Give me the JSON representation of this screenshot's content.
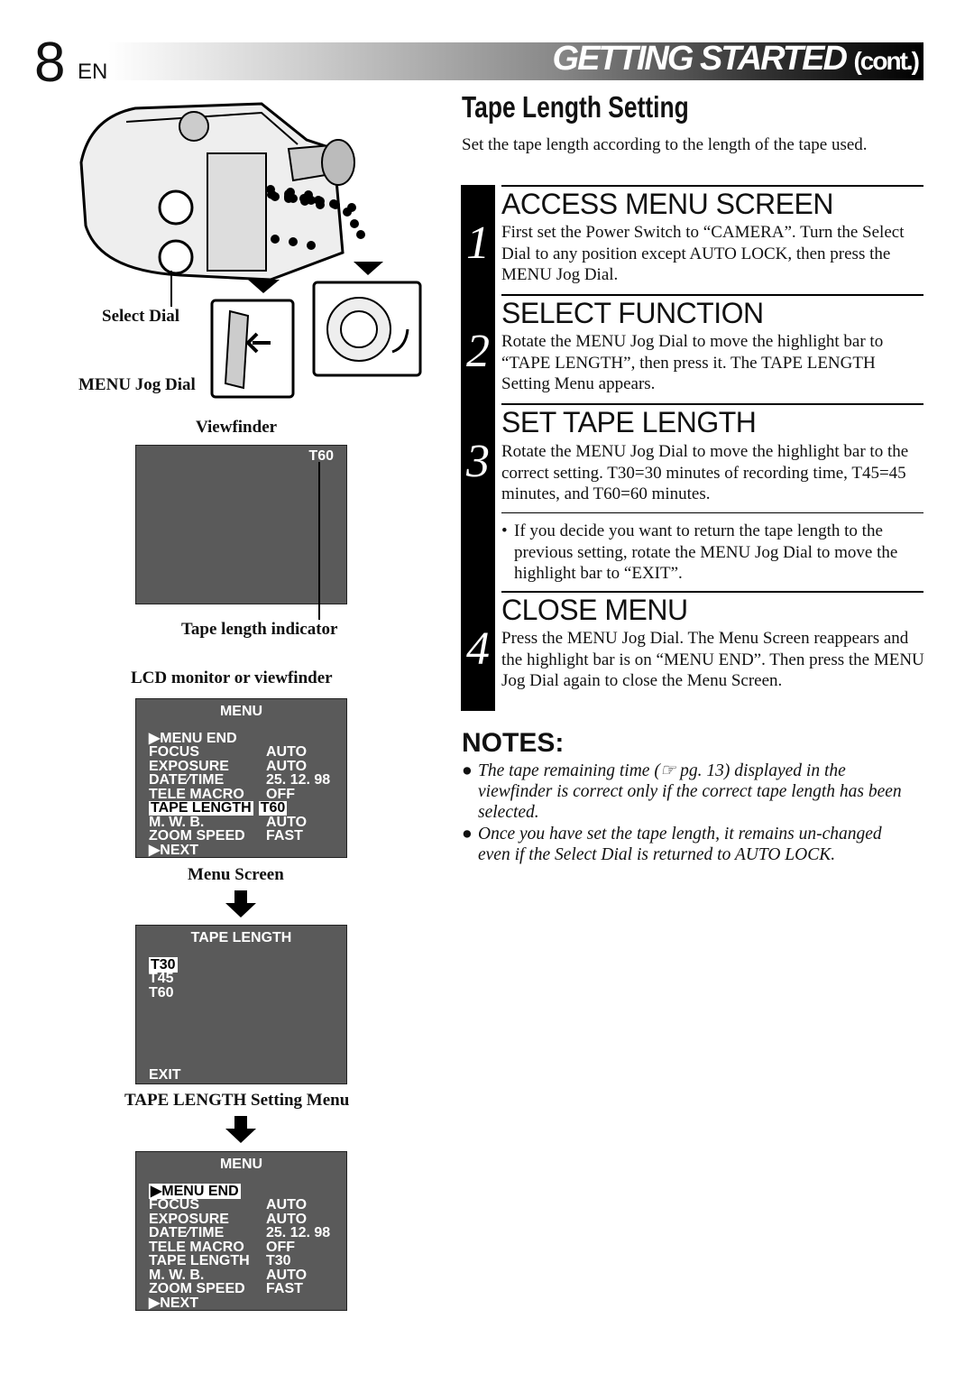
{
  "header": {
    "page_number": "8",
    "lang": "EN",
    "section": "GETTING STARTED",
    "section_suffix": "(cont.)"
  },
  "title": "Tape Length Setting",
  "intro": "Set the tape length according to the length of the tape used.",
  "left": {
    "select_dial": "Select Dial",
    "menu_jog_dial": "MENU Jog Dial",
    "viewfinder": "Viewfinder",
    "viewfinder_value": "T60",
    "tape_length_indicator": "Tape length indicator",
    "lcd_label": "LCD monitor or viewfinder",
    "menu_screen_label": "Menu Screen",
    "tape_menu_label": "TAPE LENGTH Setting Menu"
  },
  "menu1": {
    "title": "MENU",
    "menu_end": "▶MENU  END",
    "rows": [
      {
        "k": "FOCUS",
        "v": "AUTO"
      },
      {
        "k": "EXPOSURE",
        "v": "AUTO"
      },
      {
        "k": "DATE∕TIME",
        "v": "25. 12. 98"
      },
      {
        "k": "TELE  MACRO",
        "v": "OFF"
      },
      {
        "k": "TAPE  LENGTH",
        "v": "T60"
      },
      {
        "k": "M. W. B.",
        "v": "AUTO"
      },
      {
        "k": "ZOOM SPEED",
        "v": "FAST"
      }
    ],
    "next": "▶NEXT"
  },
  "tape_menu": {
    "title": "TAPE  LENGTH",
    "options": [
      "T30",
      "T45",
      "T60"
    ],
    "exit": "EXIT"
  },
  "menu2": {
    "title": "MENU",
    "menu_end": "▶MENU  END",
    "rows": [
      {
        "k": "FOCUS",
        "v": "AUTO"
      },
      {
        "k": "EXPOSURE",
        "v": "AUTO"
      },
      {
        "k": "DATE∕TIME",
        "v": "25. 12. 98"
      },
      {
        "k": "TELE  MACRO",
        "v": "OFF"
      },
      {
        "k": "TAPE  LENGTH",
        "v": "T30"
      },
      {
        "k": "M. W. B.",
        "v": "AUTO"
      },
      {
        "k": "ZOOM SPEED",
        "v": "FAST"
      }
    ],
    "next": "▶NEXT"
  },
  "steps": [
    {
      "num": "1",
      "head": "ACCESS MENU SCREEN",
      "body": "First set the Power Switch to “CAMERA”. Turn the Select Dial to any position except AUTO LOCK, then press the MENU Jog Dial."
    },
    {
      "num": "2",
      "head": "SELECT FUNCTION",
      "body": "Rotate the MENU Jog Dial to move the highlight bar to “TAPE LENGTH”, then press it. The TAPE LENGTH Setting Menu appears."
    },
    {
      "num": "3",
      "head": "SET TAPE LENGTH",
      "body": "Rotate the MENU Jog Dial to move the highlight bar to the correct setting. T30=30 minutes of recording time, T45=45 minutes, and T60=60 minutes.",
      "bullet": "If  you decide you want to return the tape length to the previous setting, rotate the MENU Jog Dial to move the highlight bar to “EXIT”."
    },
    {
      "num": "4",
      "head": "CLOSE MENU",
      "body": "Press the MENU Jog Dial. The Menu Screen reappears and the highlight bar is on “MENU END”. Then press the MENU Jog Dial again to close the Menu Screen."
    }
  ],
  "notes": {
    "title": "NOTES:",
    "items": [
      "The tape remaining time (☞ pg. 13) displayed in the viewfinder is correct only if the correct tape length has been selected.",
      "Once you have set the tape length, it remains un-changed even if the Select Dial is returned to AUTO LOCK."
    ]
  }
}
